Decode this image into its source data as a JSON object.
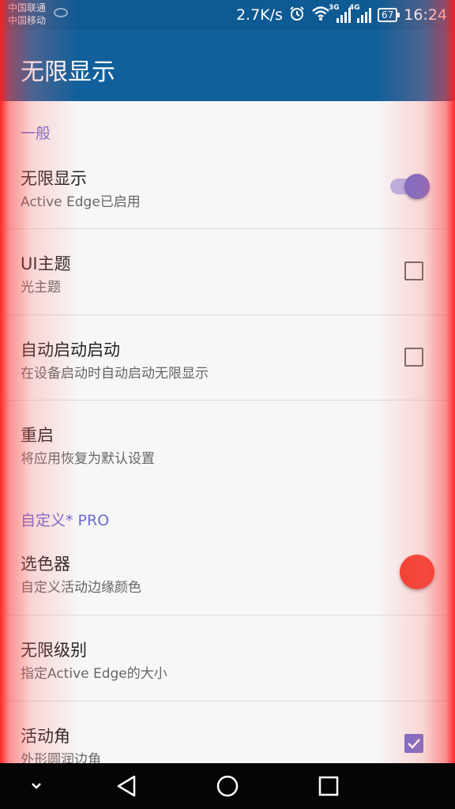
{
  "status_bar": {
    "carrier_1": "中国联通",
    "carrier_2": "中国移动",
    "speed": "2.7K/s",
    "network_a": "3G",
    "network_b": "4G",
    "battery": "67",
    "time": "16:24"
  },
  "app_bar": {
    "title": "无限显示"
  },
  "sections": {
    "general": {
      "label": "一般",
      "items": [
        {
          "title": "无限显示",
          "subtitle": "Active Edge已启用",
          "control": "switch",
          "on": true
        },
        {
          "title": "UI主题",
          "subtitle": "光主题",
          "control": "checkbox",
          "checked": false
        },
        {
          "title": "自动启动启动",
          "subtitle": "在设备启动时自动启动无限显示",
          "control": "checkbox",
          "checked": false
        },
        {
          "title": "重启",
          "subtitle": "将应用恢复为默认设置",
          "control": "none"
        }
      ]
    },
    "custom": {
      "label": "自定义* PRO",
      "items": [
        {
          "title": "选色器",
          "subtitle": "自定义活动边缘颜色",
          "control": "color",
          "color": "#f23c2e"
        },
        {
          "title": "无限级别",
          "subtitle": "指定Active Edge的大小",
          "control": "none"
        },
        {
          "title": "活动角",
          "subtitle": "外形圆润边角",
          "control": "checkbox",
          "checked": true
        }
      ]
    }
  },
  "colors": {
    "accent": "#6c6bd0",
    "app_bar": "#11609b",
    "edge_glow": "#ff1e1e"
  },
  "icons": {
    "nav_collapse": "chevron-down-icon",
    "nav_back": "triangle-back-icon",
    "nav_home": "circle-home-icon",
    "nav_recent": "square-recent-icon"
  }
}
